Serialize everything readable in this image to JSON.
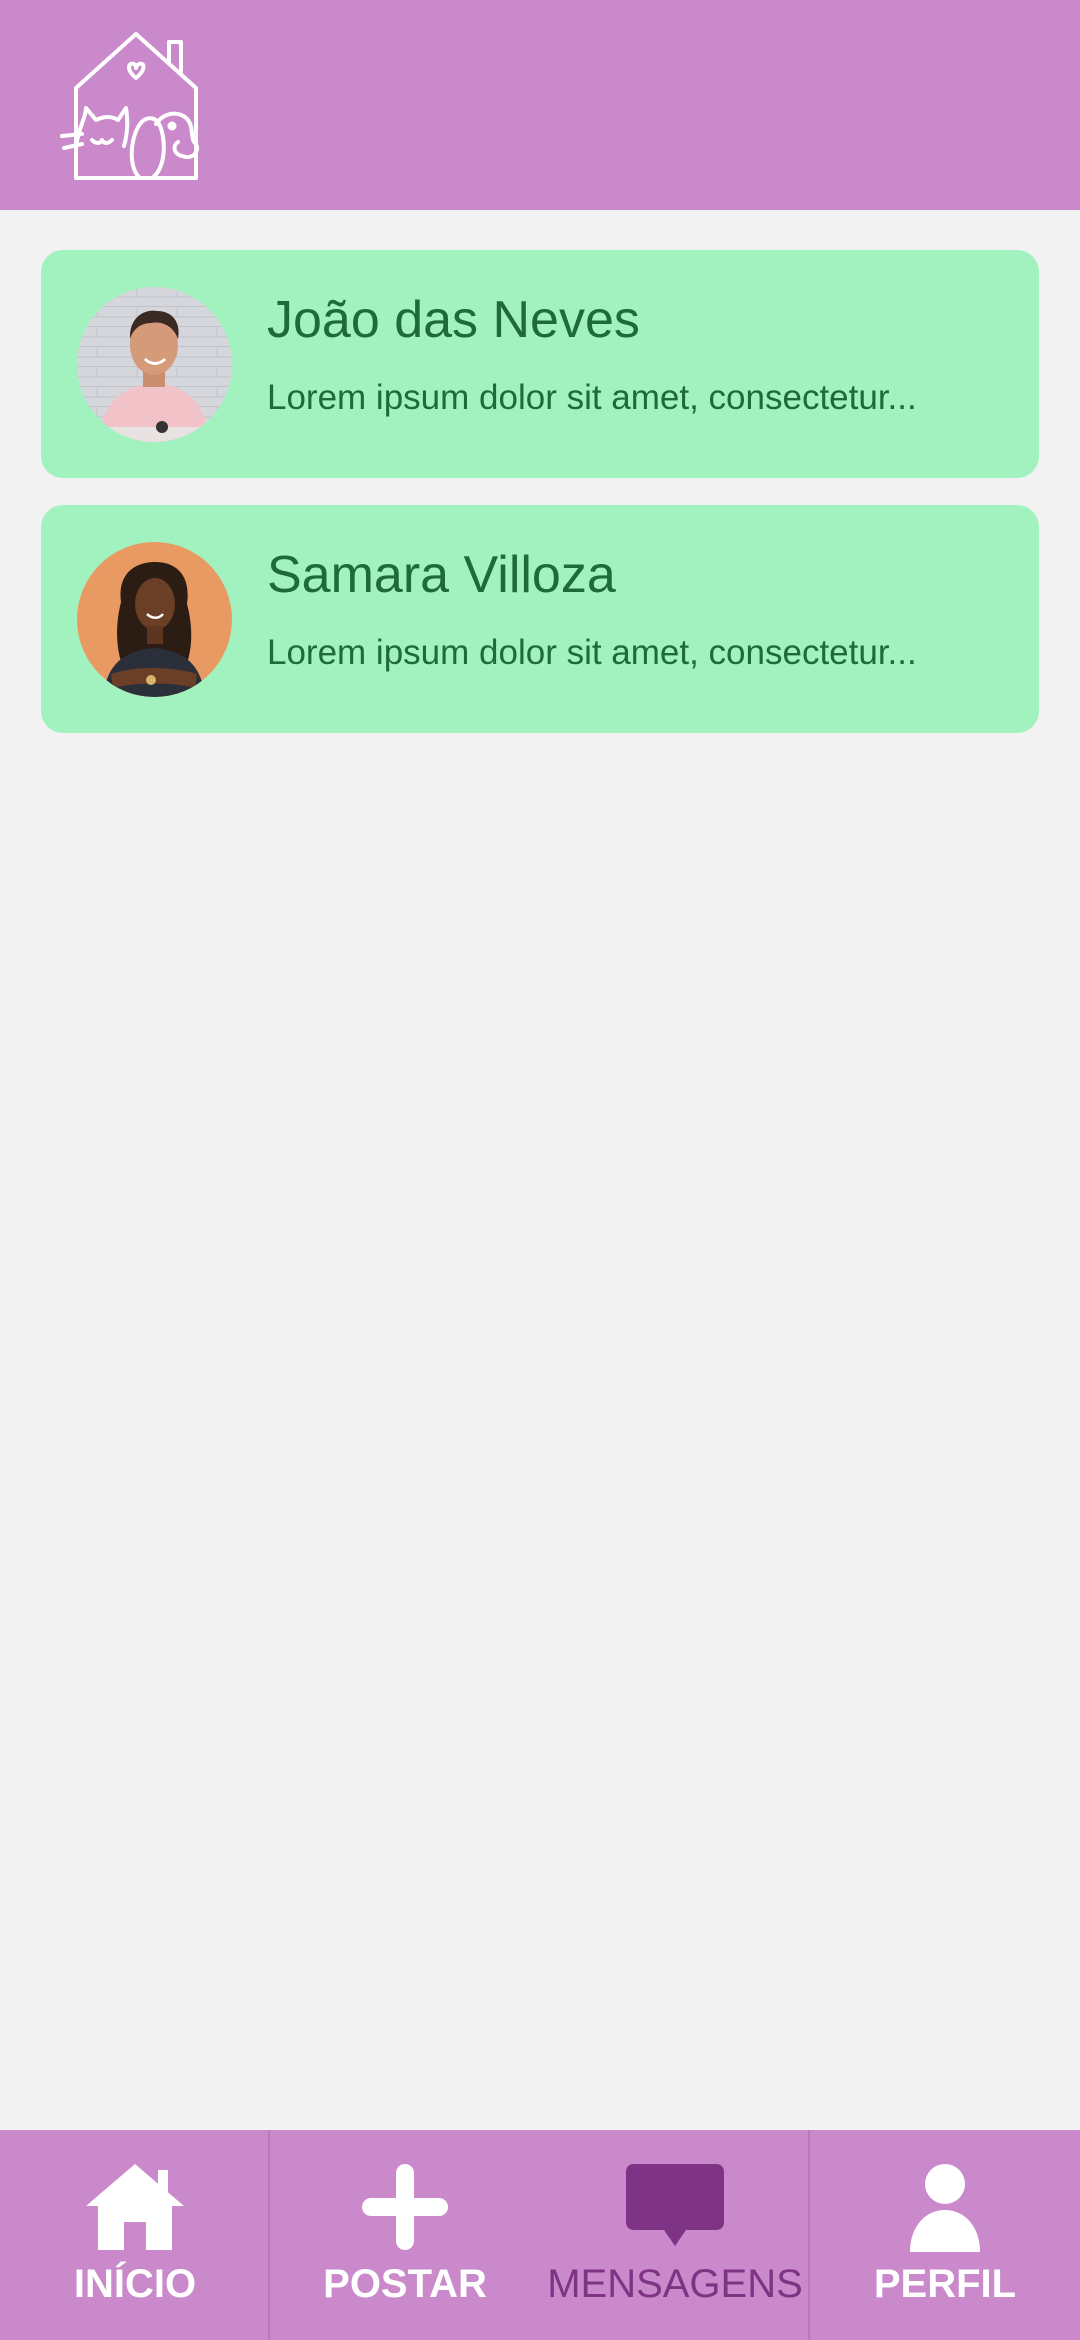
{
  "theme": {
    "header_color": "#c989cb",
    "card_color": "#a2f2bf",
    "text_green": "#1f6b37",
    "active_color": "#7e3384",
    "background": "#f2f2f2"
  },
  "header": {
    "logo_icon": "house-cat-dog-logo-icon"
  },
  "conversations": [
    {
      "name": "João das Neves",
      "preview": "Lorem ipsum dolor sit amet, consectetur...",
      "avatar_icon": "avatar-man-photo"
    },
    {
      "name": "Samara Villoza",
      "preview": "Lorem ipsum dolor sit amet, consectetur...",
      "avatar_icon": "avatar-woman-photo"
    }
  ],
  "bottom_nav": {
    "items": [
      {
        "label": "INÍCIO",
        "icon": "home-icon",
        "active": false
      },
      {
        "label": "POSTAR",
        "icon": "plus-icon",
        "active": false
      },
      {
        "label": "MENSAGENS",
        "icon": "chat-bubble-icon",
        "active": true
      },
      {
        "label": "PERFIL",
        "icon": "person-icon",
        "active": false
      }
    ]
  }
}
